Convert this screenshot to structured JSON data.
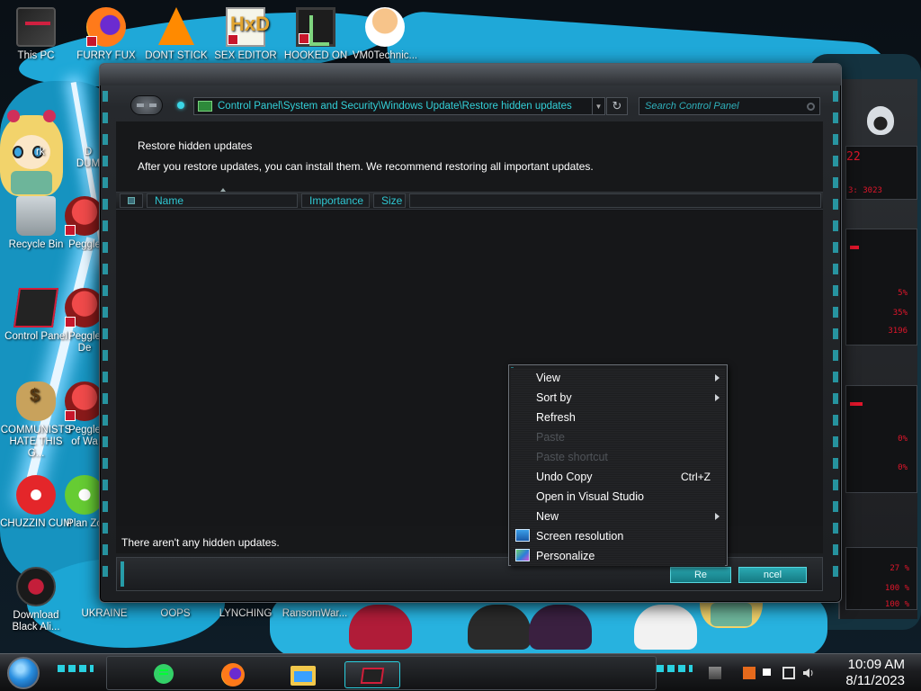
{
  "desktop": {
    "icons": [
      {
        "label": "This PC",
        "icon": "computer-icon"
      },
      {
        "label": "FURRY FUX",
        "icon": "firefox-icon"
      },
      {
        "label": "DONT STICK",
        "icon": "vlc-icon"
      },
      {
        "label": "SEX EDITOR",
        "icon": "hxd-icon"
      },
      {
        "label": "HOOKED ON",
        "icon": "game-icon"
      },
      {
        "label": "VM0Technic...",
        "icon": "doctor-icon"
      },
      {
        "label": "Recycle Bin",
        "icon": "recycle-bin-icon"
      },
      {
        "label": "Peggle",
        "icon": "peggle-icon"
      },
      {
        "label": "Control Panel",
        "icon": "control-panel-icon"
      },
      {
        "label": "Peggle De",
        "icon": "peggle-icon"
      },
      {
        "label": "COMMUNISTS HATE THIS G...",
        "icon": "money-bag-icon"
      },
      {
        "label": "Peggle of Wa",
        "icon": "peggle-icon"
      },
      {
        "label": "CHUZZIN CUM",
        "icon": "chuzzle-icon"
      },
      {
        "label": "Plan Zo",
        "icon": "plant-icon"
      },
      {
        "label": "Download Black Ali...",
        "icon": "alienware-icon"
      },
      {
        "label": "UKRAINE",
        "icon": "peggle-icon"
      },
      {
        "label": "OOPS",
        "icon": "blank-icon"
      },
      {
        "label": "LYNCHING",
        "icon": "blank-icon"
      },
      {
        "label": "RansomWar...",
        "icon": "blank-icon"
      }
    ],
    "partial_labels": {
      "dark": "rk",
      "du": "D",
      "dum": "DUM"
    }
  },
  "window": {
    "address": "Control Panel\\System and Security\\Windows Update\\Restore hidden updates",
    "search_placeholder": "Search Control Panel",
    "title": "Restore hidden updates",
    "description": "After you restore updates, you can install them. We recommend restoring all important updates.",
    "columns": [
      "Name",
      "Importance",
      "Size"
    ],
    "status": "There aren't any hidden updates.",
    "restore_button": "Re",
    "cancel_button": "ncel"
  },
  "context_menu": {
    "items": [
      {
        "label": "View",
        "submenu": true,
        "enabled": true
      },
      {
        "label": "Sort by",
        "submenu": true,
        "enabled": true
      },
      {
        "label": "Refresh",
        "enabled": true
      },
      {
        "label": "Paste",
        "enabled": false
      },
      {
        "label": "Paste shortcut",
        "enabled": false
      },
      {
        "label": "Undo Copy",
        "shortcut": "Ctrl+Z",
        "enabled": true
      },
      {
        "label": "Open in Visual Studio",
        "enabled": true
      },
      {
        "label": "New",
        "submenu": true,
        "enabled": true
      },
      {
        "label": "Screen resolution",
        "icon": "display-icon",
        "enabled": true
      },
      {
        "label": "Personalize",
        "icon": "personalize-icon",
        "enabled": true
      }
    ]
  },
  "taskbar": {
    "pinned": [
      "spotify-icon",
      "firefox-icon",
      "file-explorer-icon",
      "control-panel-icon"
    ],
    "clock_time": "10:09 AM",
    "clock_date": "8/11/2023"
  },
  "gadget": {
    "readouts": [
      "22",
      "3: 3023",
      "5%",
      "35%",
      "3196",
      "0%",
      "0%",
      "27 %",
      "100 %",
      "100 %"
    ]
  },
  "colors": {
    "accent": "#2ad0e0",
    "address_text": "#33d0d8",
    "gadget_red": "#e0162b"
  }
}
